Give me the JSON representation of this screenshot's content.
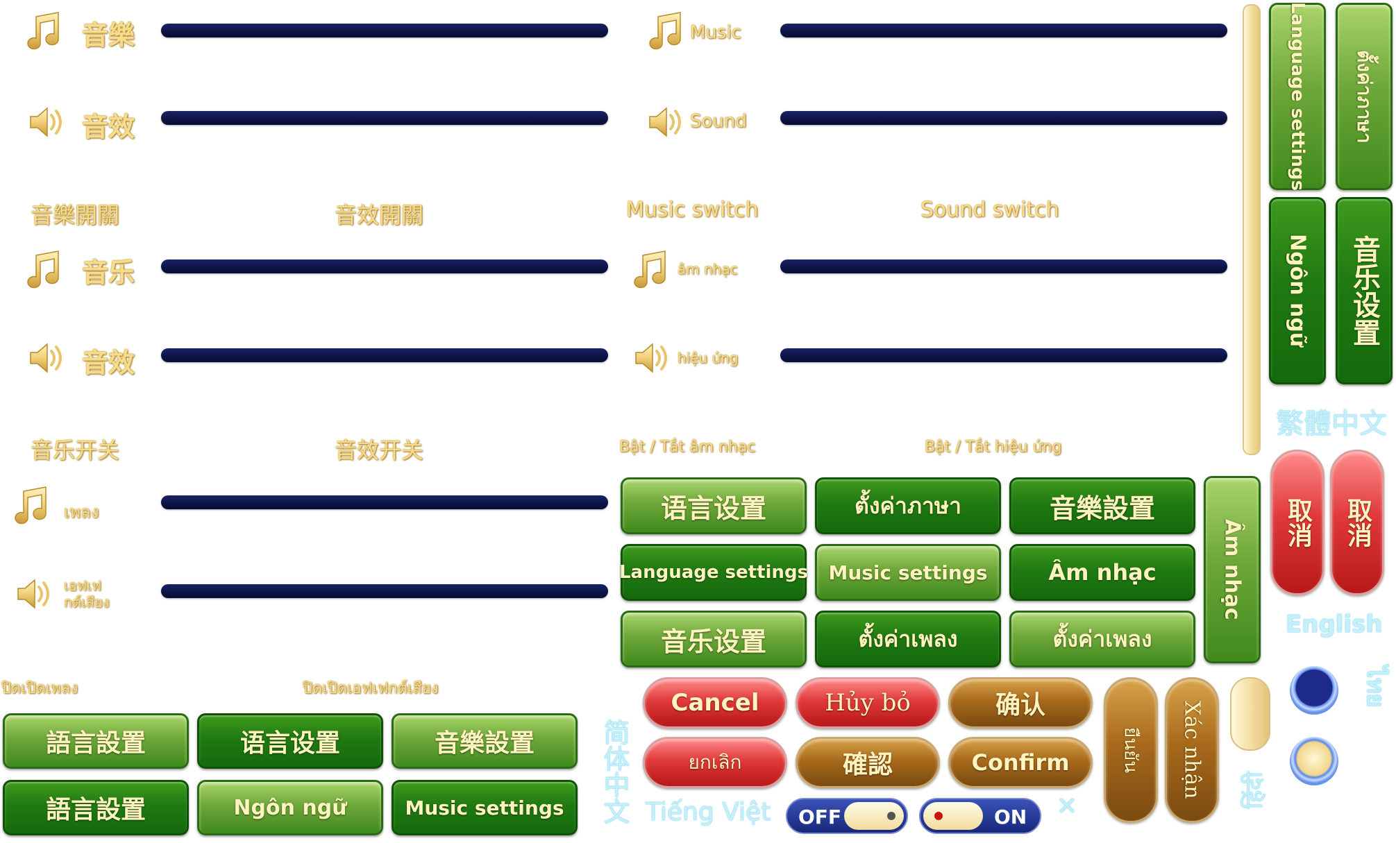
{
  "col1": {
    "music": "音樂",
    "sound": "音效",
    "music_switch": "音樂開關",
    "sound_switch": "音效開關",
    "music_sc": "音乐",
    "sound_sc": "音效",
    "music_switch_sc": "音乐开关",
    "sound_switch_sc": "音效开关",
    "music_th": "เพลง",
    "sound_th_1": "เอฟเฟ",
    "sound_th_2": "กต์เสียง",
    "music_switch_th": "ปิดเปิดเพลง",
    "sound_switch_th": "ปิดเปิดเอฟเฟกต์เสียง"
  },
  "col2": {
    "music": "Music",
    "sound": "Sound",
    "music_switch": "Music switch",
    "sound_switch": "Sound switch",
    "music_vi": "âm nhạc",
    "sound_vi": "hiệu ứng",
    "music_switch_vi": "Bật / Tắt âm nhạc",
    "sound_switch_vi": "Bật / Tắt hiệu ứng"
  },
  "vertical_buttons": {
    "language_settings": "Language settings",
    "th_language": "ตั้งค่าภาษา",
    "ngon_ngu": "Ngôn ngữ",
    "music_settings_sc": "音乐设置",
    "am_nhac": "Âm nhạc",
    "cancel_tc": "取消",
    "cancel_sc": "取消",
    "confirm_th": "ยืนยัน",
    "xac_nhan": "Xác nhận"
  },
  "grid_buttons": {
    "r1": [
      "语言设置",
      "ตั้งค่าภาษา",
      "音樂設置"
    ],
    "r2": [
      "Language settings",
      "Music settings",
      "Âm nhạc"
    ],
    "r3": [
      "音乐设置",
      "ตั้งค่าเพลง",
      "ตั้งค่าเพลง"
    ]
  },
  "bottom_buttons": {
    "r1": [
      "語言設置",
      "语言设置",
      "音樂設置"
    ],
    "r2": [
      "語言設置",
      "Ngôn ngữ",
      "Music settings"
    ]
  },
  "dialog_buttons": {
    "cancel": "Cancel",
    "huy_bo": "Hủy bỏ",
    "confirm_sc": "确认",
    "cancel_th": "ยกเลิก",
    "confirm_tc": "確認",
    "confirm": "Confirm"
  },
  "languages": {
    "traditional": "繁體中文",
    "english": "English",
    "thai": "ไทย",
    "simplified": "简体中文",
    "vietnamese": "Tiếng Việt",
    "hindi_vertical": "हिंदी"
  },
  "toggles": {
    "off": "OFF",
    "on": "ON"
  },
  "close_symbol": "✕",
  "colors": {
    "gold_text": "#f6dc8c",
    "slider_bar": "#0c1444",
    "green_dark": "#207a12",
    "green_light": "#6ea73a",
    "red": "#e03a3a",
    "brown": "#a86a1c",
    "cyan_text": "#c5f0fb"
  }
}
